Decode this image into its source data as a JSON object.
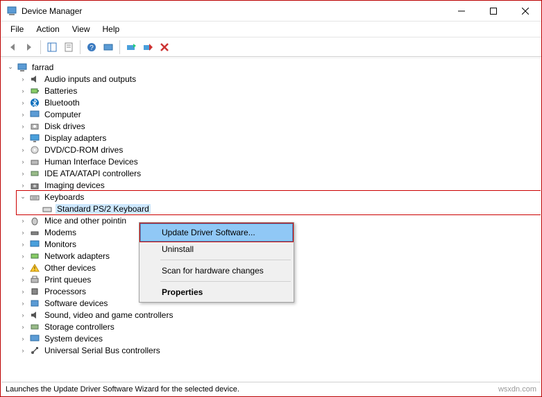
{
  "window": {
    "title": "Device Manager"
  },
  "menus": {
    "file": "File",
    "action": "Action",
    "view": "View",
    "help": "Help"
  },
  "tree": {
    "root": "farrad",
    "nodes": {
      "audio": "Audio inputs and outputs",
      "batteries": "Batteries",
      "bluetooth": "Bluetooth",
      "computer": "Computer",
      "disk": "Disk drives",
      "display": "Display adapters",
      "dvd": "DVD/CD-ROM drives",
      "hid": "Human Interface Devices",
      "ide": "IDE ATA/ATAPI controllers",
      "imaging": "Imaging devices",
      "keyboards": "Keyboards",
      "keyboard_item": "Standard PS/2 Keyboard",
      "mice": "Mice and other pointin",
      "modems": "Modems",
      "monitors": "Monitors",
      "network": "Network adapters",
      "other": "Other devices",
      "printq": "Print queues",
      "processors": "Processors",
      "software": "Software devices",
      "sound": "Sound, video and game controllers",
      "storage": "Storage controllers",
      "system": "System devices",
      "usb": "Universal Serial Bus controllers"
    }
  },
  "context_menu": {
    "update": "Update Driver Software...",
    "uninstall": "Uninstall",
    "scan": "Scan for hardware changes",
    "properties": "Properties"
  },
  "status": "Launches the Update Driver Software Wizard for the selected device.",
  "watermark": "wsxdn.com"
}
